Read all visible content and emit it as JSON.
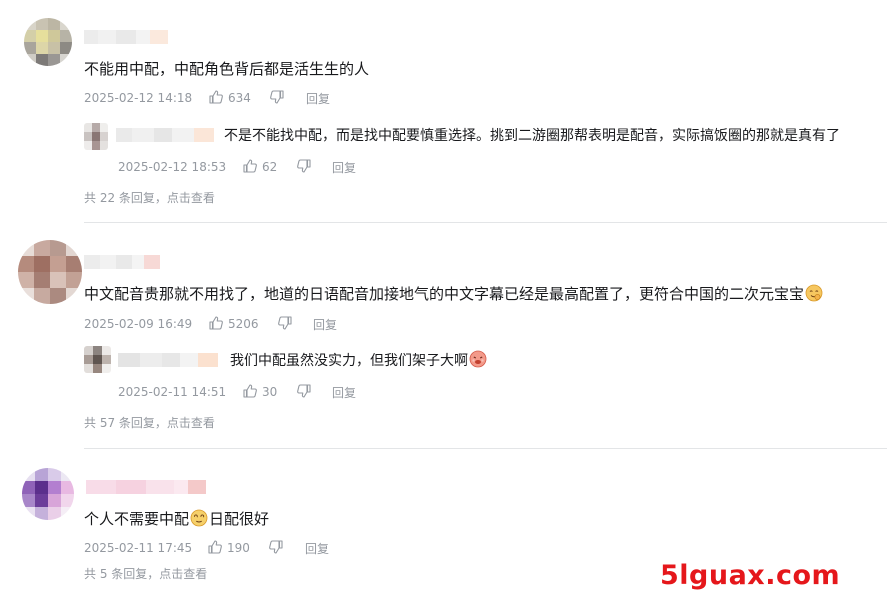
{
  "comments": [
    {
      "text": "不能用中配，中配角色背后都是活生生的人",
      "date": "2025-02-12 14:18",
      "likes": "634",
      "reply_label": "回复",
      "reply": {
        "text": "不是不能找中配，而是找中配要慎重选择。挑到二游圈那帮表明是配音，实际搞饭圈的那就是真有了",
        "date": "2025-02-12 18:53",
        "likes": "62",
        "reply_label": "回复"
      },
      "more_replies": "共 22 条回复，点击查看"
    },
    {
      "text": "中文配音贵那就不用找了，地道的日语配音加接地气的中文字幕已经是最高配置了，更符合中国的二次元宝宝",
      "date": "2025-02-09 16:49",
      "likes": "5206",
      "reply_label": "回复",
      "reply": {
        "text": "我们中配虽然没实力，但我们架子大啊",
        "date": "2025-02-11 14:51",
        "likes": "30",
        "reply_label": "回复"
      },
      "more_replies": "共 57 条回复，点击查看"
    },
    {
      "text_before_emoji": "个人不需要中配",
      "text_after_emoji": "日配很好",
      "date": "2025-02-11 17:45",
      "likes": "190",
      "reply_label": "回复",
      "more_replies": "共 5 条回复，点击查看"
    }
  ],
  "icons": {
    "like": "thumbs-up-icon",
    "dislike": "thumbs-down-icon",
    "emoji_1": "ok-hand-emoji-icon",
    "emoji_2": "drooling-emoji-icon",
    "emoji_3": "dizzy-emoji-icon"
  },
  "watermark": "5lguax.com",
  "colors": {
    "text": "#18191c",
    "meta": "#9499a0",
    "divider": "#e3e5e7",
    "watermark": "#e5171b"
  }
}
